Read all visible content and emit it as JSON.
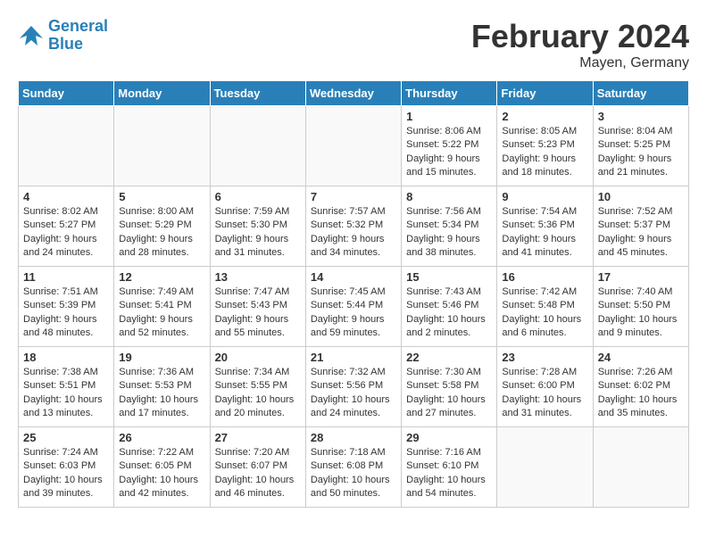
{
  "header": {
    "logo_line1": "General",
    "logo_line2": "Blue",
    "month": "February 2024",
    "location": "Mayen, Germany"
  },
  "weekdays": [
    "Sunday",
    "Monday",
    "Tuesday",
    "Wednesday",
    "Thursday",
    "Friday",
    "Saturday"
  ],
  "weeks": [
    [
      {
        "day": "",
        "info": "",
        "empty": true
      },
      {
        "day": "",
        "info": "",
        "empty": true
      },
      {
        "day": "",
        "info": "",
        "empty": true
      },
      {
        "day": "",
        "info": "",
        "empty": true
      },
      {
        "day": "1",
        "info": "Sunrise: 8:06 AM\nSunset: 5:22 PM\nDaylight: 9 hours\nand 15 minutes."
      },
      {
        "day": "2",
        "info": "Sunrise: 8:05 AM\nSunset: 5:23 PM\nDaylight: 9 hours\nand 18 minutes."
      },
      {
        "day": "3",
        "info": "Sunrise: 8:04 AM\nSunset: 5:25 PM\nDaylight: 9 hours\nand 21 minutes."
      }
    ],
    [
      {
        "day": "4",
        "info": "Sunrise: 8:02 AM\nSunset: 5:27 PM\nDaylight: 9 hours\nand 24 minutes."
      },
      {
        "day": "5",
        "info": "Sunrise: 8:00 AM\nSunset: 5:29 PM\nDaylight: 9 hours\nand 28 minutes."
      },
      {
        "day": "6",
        "info": "Sunrise: 7:59 AM\nSunset: 5:30 PM\nDaylight: 9 hours\nand 31 minutes."
      },
      {
        "day": "7",
        "info": "Sunrise: 7:57 AM\nSunset: 5:32 PM\nDaylight: 9 hours\nand 34 minutes."
      },
      {
        "day": "8",
        "info": "Sunrise: 7:56 AM\nSunset: 5:34 PM\nDaylight: 9 hours\nand 38 minutes."
      },
      {
        "day": "9",
        "info": "Sunrise: 7:54 AM\nSunset: 5:36 PM\nDaylight: 9 hours\nand 41 minutes."
      },
      {
        "day": "10",
        "info": "Sunrise: 7:52 AM\nSunset: 5:37 PM\nDaylight: 9 hours\nand 45 minutes."
      }
    ],
    [
      {
        "day": "11",
        "info": "Sunrise: 7:51 AM\nSunset: 5:39 PM\nDaylight: 9 hours\nand 48 minutes."
      },
      {
        "day": "12",
        "info": "Sunrise: 7:49 AM\nSunset: 5:41 PM\nDaylight: 9 hours\nand 52 minutes."
      },
      {
        "day": "13",
        "info": "Sunrise: 7:47 AM\nSunset: 5:43 PM\nDaylight: 9 hours\nand 55 minutes."
      },
      {
        "day": "14",
        "info": "Sunrise: 7:45 AM\nSunset: 5:44 PM\nDaylight: 9 hours\nand 59 minutes."
      },
      {
        "day": "15",
        "info": "Sunrise: 7:43 AM\nSunset: 5:46 PM\nDaylight: 10 hours\nand 2 minutes."
      },
      {
        "day": "16",
        "info": "Sunrise: 7:42 AM\nSunset: 5:48 PM\nDaylight: 10 hours\nand 6 minutes."
      },
      {
        "day": "17",
        "info": "Sunrise: 7:40 AM\nSunset: 5:50 PM\nDaylight: 10 hours\nand 9 minutes."
      }
    ],
    [
      {
        "day": "18",
        "info": "Sunrise: 7:38 AM\nSunset: 5:51 PM\nDaylight: 10 hours\nand 13 minutes."
      },
      {
        "day": "19",
        "info": "Sunrise: 7:36 AM\nSunset: 5:53 PM\nDaylight: 10 hours\nand 17 minutes."
      },
      {
        "day": "20",
        "info": "Sunrise: 7:34 AM\nSunset: 5:55 PM\nDaylight: 10 hours\nand 20 minutes."
      },
      {
        "day": "21",
        "info": "Sunrise: 7:32 AM\nSunset: 5:56 PM\nDaylight: 10 hours\nand 24 minutes."
      },
      {
        "day": "22",
        "info": "Sunrise: 7:30 AM\nSunset: 5:58 PM\nDaylight: 10 hours\nand 27 minutes."
      },
      {
        "day": "23",
        "info": "Sunrise: 7:28 AM\nSunset: 6:00 PM\nDaylight: 10 hours\nand 31 minutes."
      },
      {
        "day": "24",
        "info": "Sunrise: 7:26 AM\nSunset: 6:02 PM\nDaylight: 10 hours\nand 35 minutes."
      }
    ],
    [
      {
        "day": "25",
        "info": "Sunrise: 7:24 AM\nSunset: 6:03 PM\nDaylight: 10 hours\nand 39 minutes."
      },
      {
        "day": "26",
        "info": "Sunrise: 7:22 AM\nSunset: 6:05 PM\nDaylight: 10 hours\nand 42 minutes."
      },
      {
        "day": "27",
        "info": "Sunrise: 7:20 AM\nSunset: 6:07 PM\nDaylight: 10 hours\nand 46 minutes."
      },
      {
        "day": "28",
        "info": "Sunrise: 7:18 AM\nSunset: 6:08 PM\nDaylight: 10 hours\nand 50 minutes."
      },
      {
        "day": "29",
        "info": "Sunrise: 7:16 AM\nSunset: 6:10 PM\nDaylight: 10 hours\nand 54 minutes."
      },
      {
        "day": "",
        "info": "",
        "empty": true
      },
      {
        "day": "",
        "info": "",
        "empty": true
      }
    ]
  ]
}
